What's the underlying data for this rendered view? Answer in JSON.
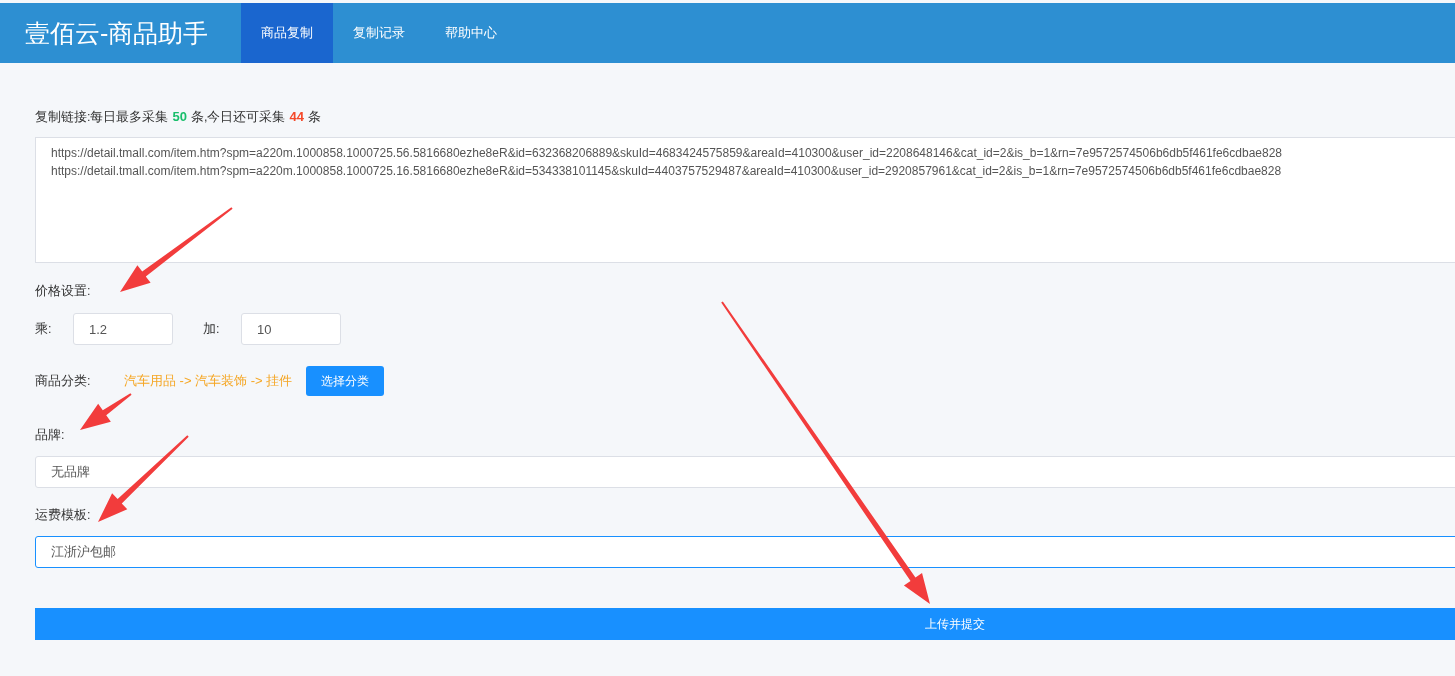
{
  "header": {
    "title": "壹佰云-商品助手"
  },
  "nav_tabs": [
    {
      "label": "商品复制",
      "selected": true
    },
    {
      "label": "复制记录",
      "selected": false
    },
    {
      "label": "帮助中心",
      "selected": false
    }
  ],
  "quota": {
    "label": "复制链接:每日最多采集",
    "max": "50",
    "middle": "条,今日还可采集",
    "remaining": "44",
    "unit": "条"
  },
  "links": {
    "value": [
      "https://detail.tmall.com/item.htm?spm=a220m.1000858.1000725.56.5816680ezhe8eR&id=632368206889&skuId=4683424575859&areaId=410300&user_id=2208648146&cat_id=2&is_b=1&rn=7e9572574506b6db5f461fe6cdbae828",
      "https://detail.tmall.com/item.htm?spm=a220m.1000858.1000725.16.5816680ezhe8eR&id=534338101145&skuId=4403757529487&areaId=410300&user_id=2920857961&cat_id=2&is_b=1&rn=7e9572574506b6db5f461fe6cdbae828"
    ]
  },
  "price": {
    "label": "价格设置:",
    "multiply_label": "乘:",
    "multiply_value": "1.2",
    "add_label": "加:",
    "add_value": "10"
  },
  "category": {
    "label": "商品分类:",
    "path": "汽车用品 -> 汽车装饰 -> 挂件",
    "button": "选择分类"
  },
  "brand": {
    "label": "品牌:",
    "value": "无品牌"
  },
  "freight": {
    "label": "运费模板:",
    "value": "江浙沪包邮",
    "focused": true
  },
  "submit_button": "上传并提交"
}
